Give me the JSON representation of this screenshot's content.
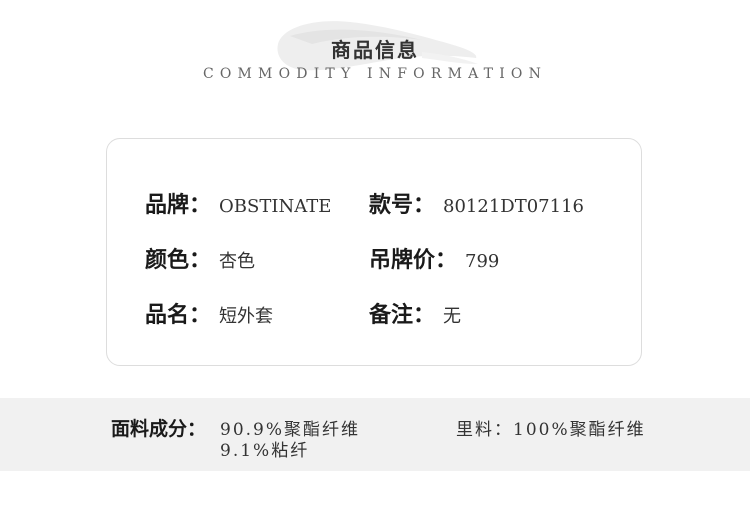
{
  "header": {
    "title_cn": "商品信息",
    "title_en": "COMMODITY INFORMATION"
  },
  "info": {
    "brand": {
      "label": "品牌：",
      "value": "OBSTINATE"
    },
    "style_no": {
      "label": "款号：",
      "value": "80121DT07116"
    },
    "color": {
      "label": "颜色：",
      "value": "杏色"
    },
    "tag_price": {
      "label": "吊牌价：",
      "value": "799"
    },
    "name": {
      "label": "品名：",
      "value": "短外套"
    },
    "remark": {
      "label": "备注：",
      "value": "无"
    }
  },
  "material": {
    "fabric_label": "面料成分：",
    "fabric_lines": [
      "90.9%聚酯纤维",
      "9.1%粘纤"
    ],
    "lining": "里料：100%聚酯纤维"
  },
  "colors": {
    "band_background": "#f1f1f1",
    "card_border": "#dddddd",
    "text_dark": "#1a1a1a",
    "text_muted": "#666666"
  }
}
